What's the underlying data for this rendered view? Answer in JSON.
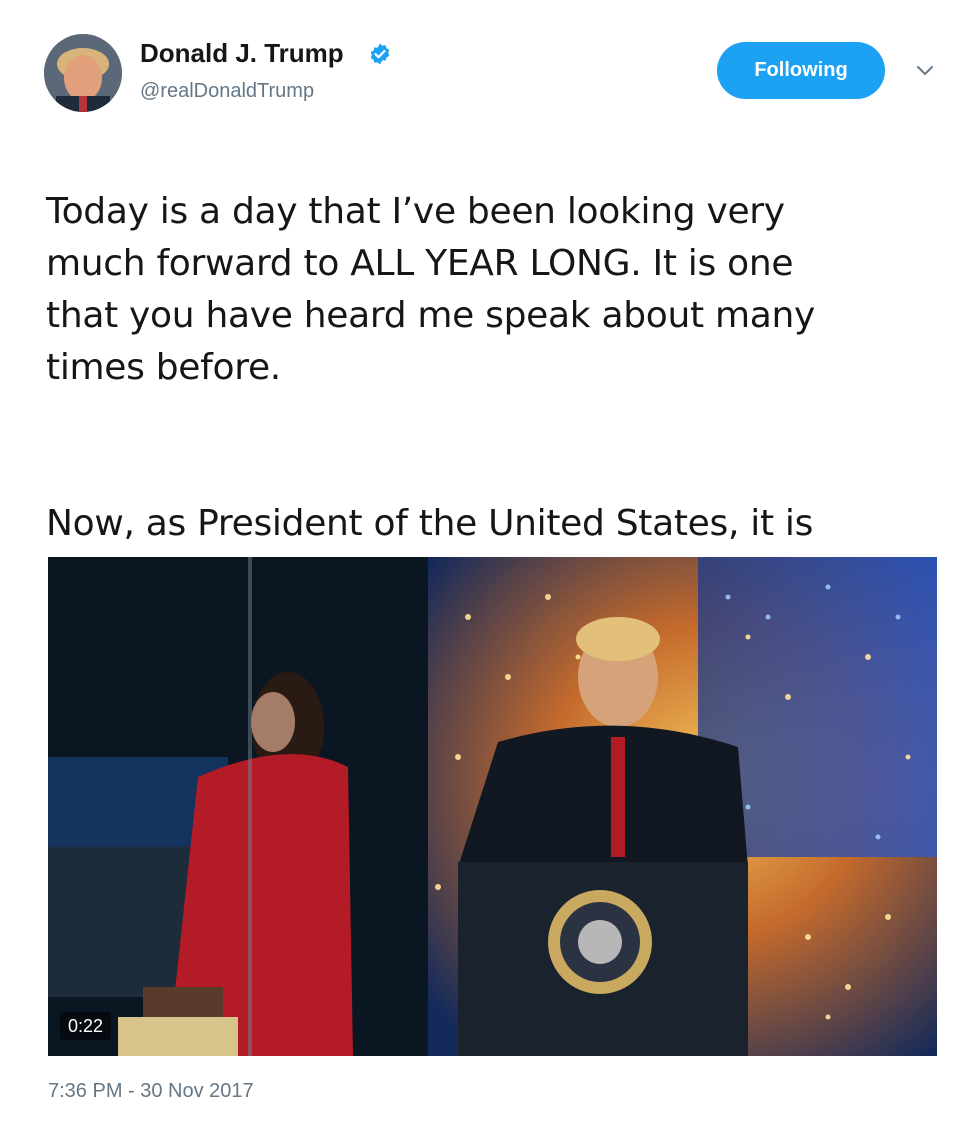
{
  "author": {
    "display_name": "Donald J. Trump",
    "handle": "@realDonaldTrump",
    "verified": true,
    "verified_icon": "verified-badge-icon"
  },
  "actions": {
    "follow_label": "Following",
    "menu_icon": "chevron-down-icon"
  },
  "tweet": {
    "paragraph_1": "Today is a day that I’ve been looking very\nmuch forward to ALL YEAR LONG. It is one\nthat you have heard me speak about many\ntimes before.",
    "paragraph_2": "Now, as President of the United States, it is\nmy tremendous honor to finally wish America\nand the world, a very MERRY CHRISTMAS!"
  },
  "media": {
    "type": "video",
    "duration": "0:22"
  },
  "meta": {
    "timestamp": "7:36 PM - 30 Nov 2017"
  },
  "colors": {
    "accent": "#1da1f2",
    "secondary_text": "#657786",
    "primary_text": "#14171a"
  }
}
